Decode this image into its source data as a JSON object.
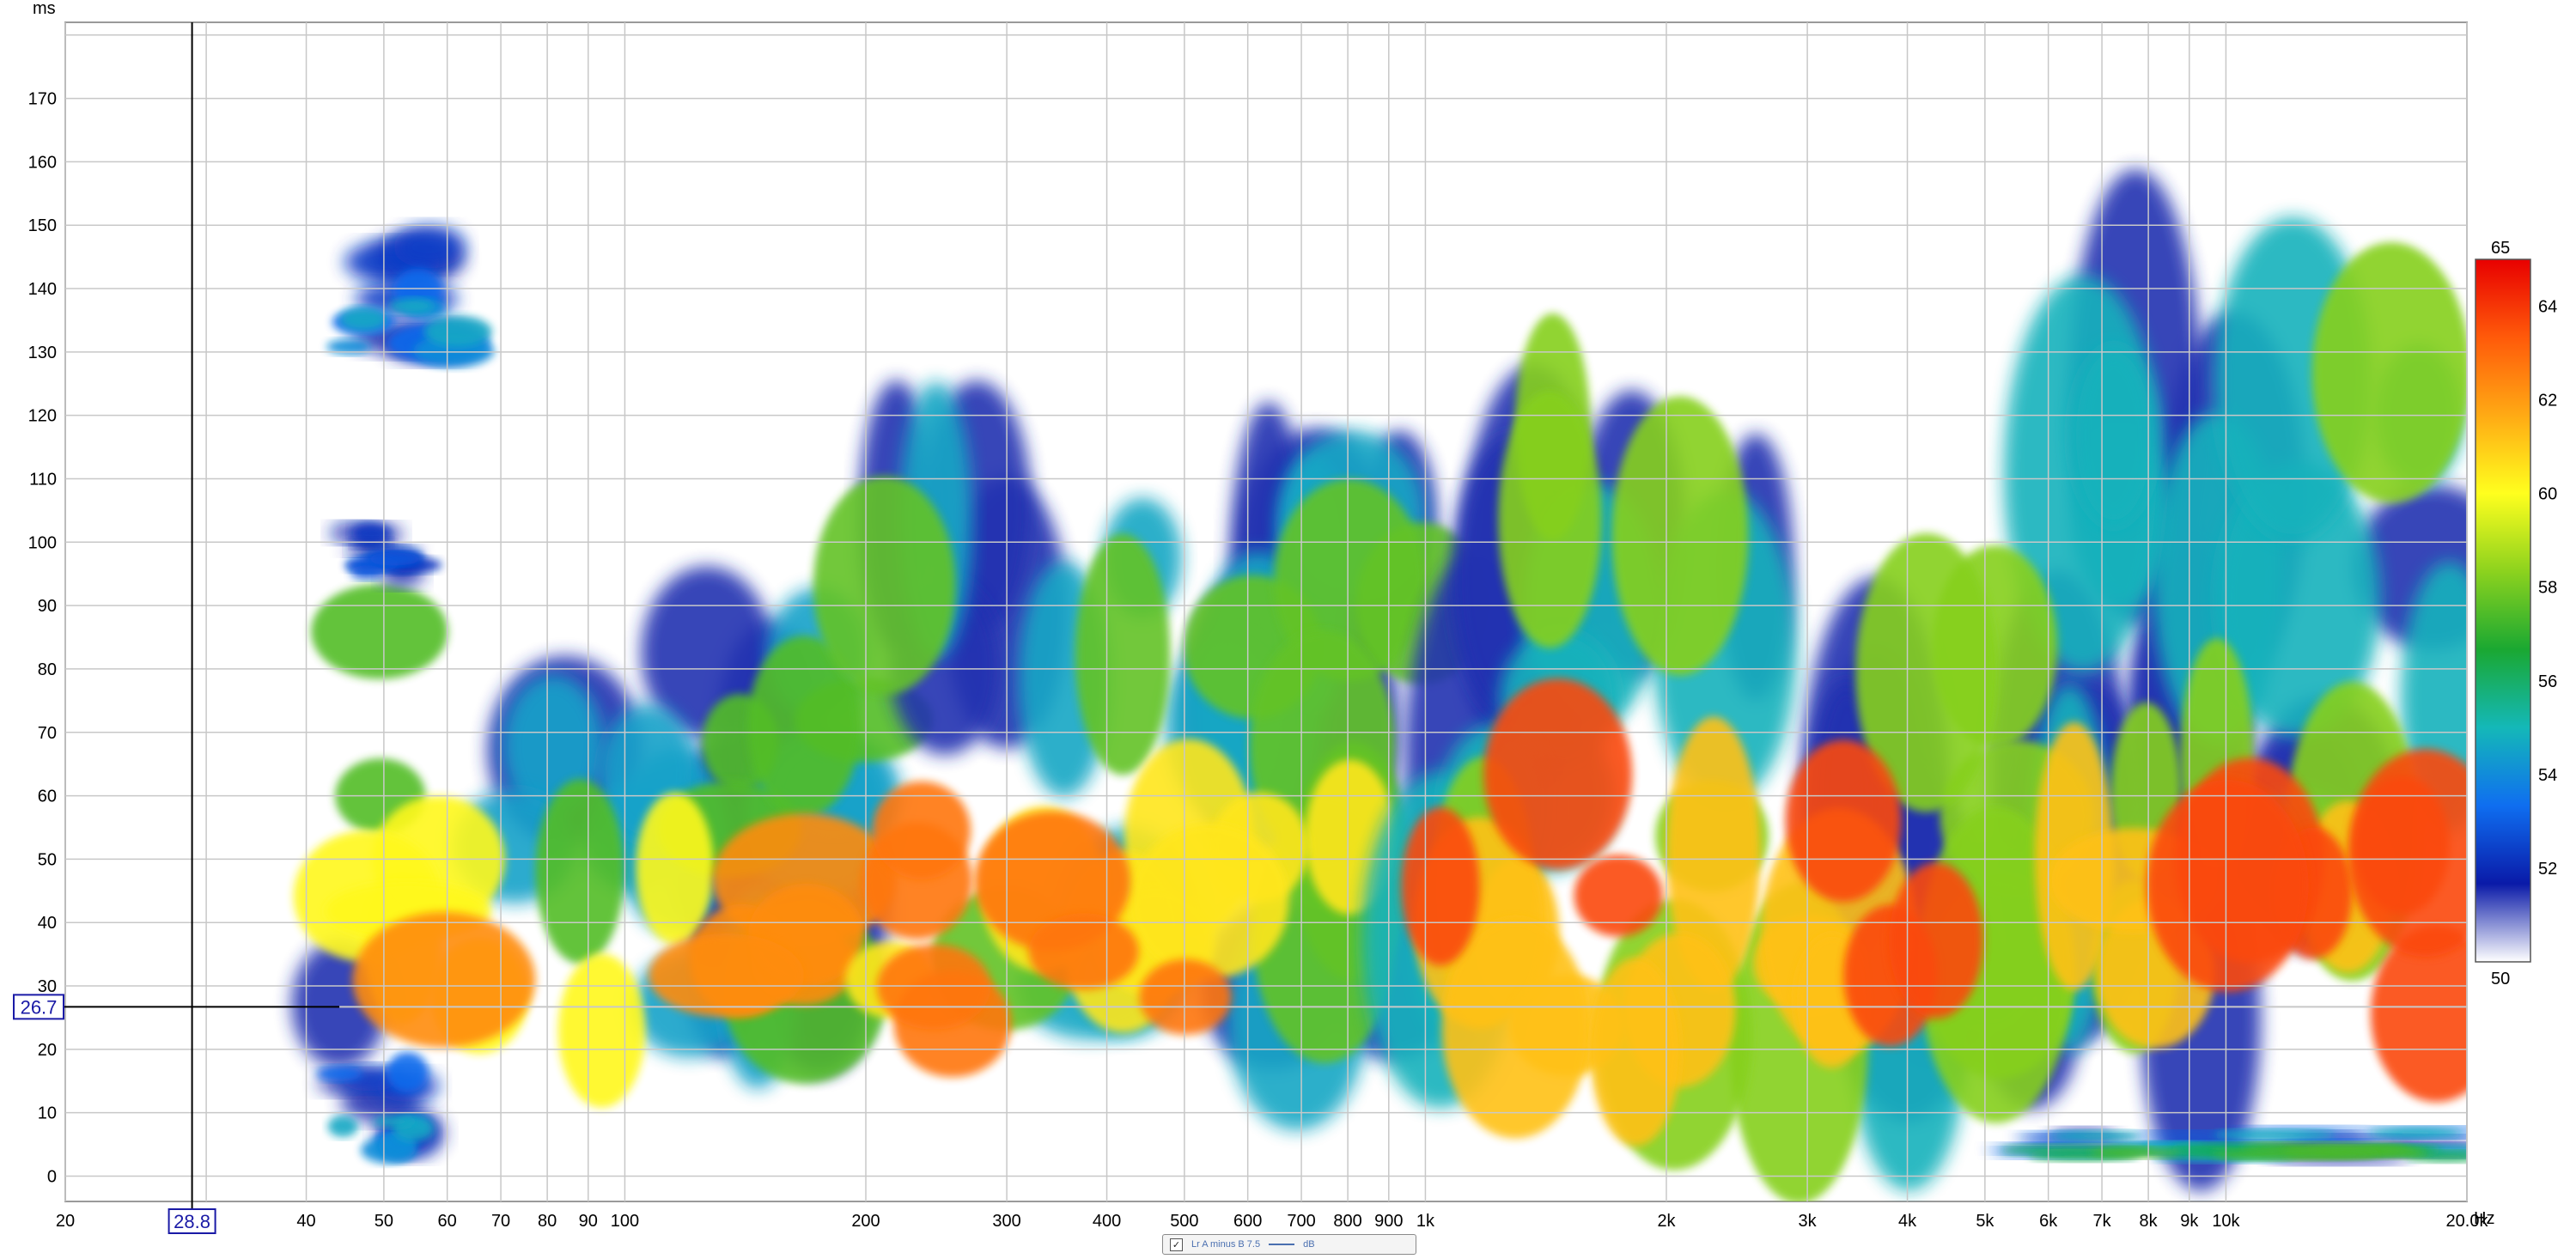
{
  "chart_data": {
    "type": "heatmap",
    "title": "",
    "xlabel": "",
    "ylabel": "",
    "x_unit": "Hz",
    "y_unit": "ms",
    "x_scale": "log",
    "xlim": [
      20,
      20000
    ],
    "ylim": [
      -4,
      182
    ],
    "x_ticks": [
      {
        "value": 20,
        "label": "20"
      },
      {
        "value": 40,
        "label": "40"
      },
      {
        "value": 50,
        "label": "50"
      },
      {
        "value": 60,
        "label": "60"
      },
      {
        "value": 70,
        "label": "70"
      },
      {
        "value": 80,
        "label": "80"
      },
      {
        "value": 90,
        "label": "90"
      },
      {
        "value": 100,
        "label": "100"
      },
      {
        "value": 200,
        "label": "200"
      },
      {
        "value": 300,
        "label": "300"
      },
      {
        "value": 400,
        "label": "400"
      },
      {
        "value": 500,
        "label": "500"
      },
      {
        "value": 600,
        "label": "600"
      },
      {
        "value": 700,
        "label": "700"
      },
      {
        "value": 800,
        "label": "800"
      },
      {
        "value": 900,
        "label": "900"
      },
      {
        "value": 1000,
        "label": "1k"
      },
      {
        "value": 2000,
        "label": "2k"
      },
      {
        "value": 3000,
        "label": "3k"
      },
      {
        "value": 4000,
        "label": "4k"
      },
      {
        "value": 5000,
        "label": "5k"
      },
      {
        "value": 6000,
        "label": "6k"
      },
      {
        "value": 7000,
        "label": "7k"
      },
      {
        "value": 8000,
        "label": "8k"
      },
      {
        "value": 9000,
        "label": "9k"
      },
      {
        "value": 10000,
        "label": "10k"
      },
      {
        "value": 20000,
        "label": "20.0k"
      }
    ],
    "y_ticks": [
      0,
      10,
      20,
      30,
      40,
      50,
      60,
      70,
      80,
      90,
      100,
      110,
      120,
      130,
      140,
      150,
      160,
      170
    ],
    "grid": true,
    "colorbar": {
      "min": 50,
      "max": 65,
      "min_label": "50",
      "max_label": "65",
      "ticks": [
        52,
        54,
        56,
        58,
        60,
        62,
        64
      ],
      "colors": [
        "#ffffff",
        "#0a1aa8",
        "#0f6ef0",
        "#14b8b8",
        "#1aa832",
        "#8cd21e",
        "#ffff1e",
        "#ffaa14",
        "#ff5a0a",
        "#e80000"
      ]
    },
    "cursor": {
      "x": 28.8,
      "y": 26.7,
      "x_label": "28.8",
      "y_label": "26.7"
    },
    "regions": [
      {
        "f_min": 44,
        "f_max": 200,
        "t_min": 22,
        "t_max": 86,
        "peak_db": 63.5
      },
      {
        "f_min": 44,
        "f_max": 62,
        "t_min": 130,
        "t_max": 147,
        "peak_db": 55
      },
      {
        "f_min": 44,
        "f_max": 55,
        "t_min": 95,
        "t_max": 102,
        "peak_db": 53
      },
      {
        "f_min": 44,
        "f_max": 55,
        "t_min": 4,
        "t_max": 18,
        "peak_db": 55
      },
      {
        "f_min": 200,
        "f_max": 1000,
        "t_min": 22,
        "t_max": 108,
        "peak_db": 64
      },
      {
        "f_min": 1000,
        "f_max": 20000,
        "t_min": 18,
        "t_max": 128,
        "peak_db": 65
      },
      {
        "f_min": 6000,
        "f_max": 20000,
        "t_min": 3,
        "t_max": 7,
        "peak_db": 58
      }
    ],
    "legend": {
      "checked": true,
      "series": "Lr A minus B 7.5",
      "unit": "dB"
    }
  }
}
